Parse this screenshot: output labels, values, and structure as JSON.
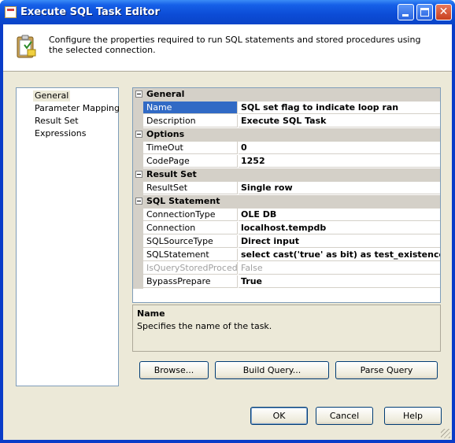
{
  "window": {
    "title": "Execute SQL Task Editor",
    "close_glyph": "✕"
  },
  "header": {
    "description": "Configure the properties required to run SQL statements and stored procedures using the selected connection.",
    "icon": "sql-task-clipboard-icon"
  },
  "nav": {
    "items": [
      {
        "label": "General",
        "selected": true
      },
      {
        "label": "Parameter Mapping",
        "selected": false
      },
      {
        "label": "Result Set",
        "selected": false
      },
      {
        "label": "Expressions",
        "selected": false
      }
    ]
  },
  "grid": {
    "categories": {
      "general": "General",
      "options": "Options",
      "result_set": "Result Set",
      "sql_statement": "SQL Statement"
    },
    "rows": {
      "name": {
        "label": "Name",
        "value": "SQL set flag to indicate loop ran"
      },
      "description": {
        "label": "Description",
        "value": "Execute SQL Task"
      },
      "timeout": {
        "label": "TimeOut",
        "value": "0"
      },
      "codepage": {
        "label": "CodePage",
        "value": "1252"
      },
      "resultset": {
        "label": "ResultSet",
        "value": "Single row"
      },
      "connectiontype": {
        "label": "ConnectionType",
        "value": "OLE DB"
      },
      "connection": {
        "label": "Connection",
        "value": "localhost.tempdb"
      },
      "sqlsourcetype": {
        "label": "SQLSourceType",
        "value": "Direct input"
      },
      "sqlstatement": {
        "label": "SQLStatement",
        "value": "select cast('true' as bit) as test_existence"
      },
      "isquerystoredprocedure": {
        "label": "IsQueryStoredProcedur",
        "value": "False"
      },
      "bypassprepare": {
        "label": "BypassPrepare",
        "value": "True"
      }
    }
  },
  "description_panel": {
    "title": "Name",
    "text": "Specifies the name of the task."
  },
  "buttons": {
    "browse": "Browse...",
    "build_query": "Build Query...",
    "parse_query": "Parse Query",
    "ok": "OK",
    "cancel": "Cancel",
    "help": "Help"
  },
  "colors": {
    "title_bar": "#0a44c8",
    "dialog_bg": "#ece9d8",
    "selection": "#316ac5"
  }
}
